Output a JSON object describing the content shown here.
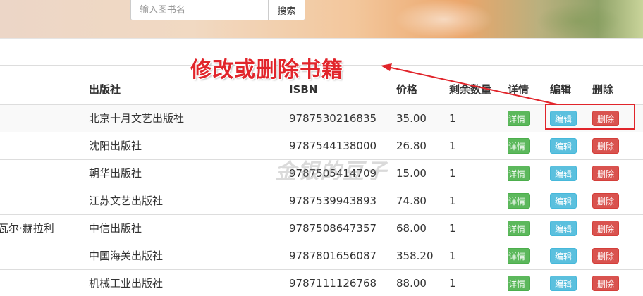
{
  "search": {
    "placeholder": "输入图书名",
    "button_label": "搜索"
  },
  "table": {
    "headers": {
      "publisher": "出版社",
      "isbn": "ISBN",
      "price": "价格",
      "remaining": "剩余数量",
      "detail": "详情",
      "edit": "编辑",
      "delete": "删除"
    },
    "rows": [
      {
        "author": "",
        "publisher": "北京十月文艺出版社",
        "isbn": "9787530216835",
        "price": "35.00",
        "remaining": "1"
      },
      {
        "author": "",
        "publisher": "沈阳出版社",
        "isbn": "9787544138000",
        "price": "26.80",
        "remaining": "1"
      },
      {
        "author": "",
        "publisher": "朝华出版社",
        "isbn": "9787505414709",
        "price": "15.00",
        "remaining": "1"
      },
      {
        "author": "",
        "publisher": "江苏文艺出版社",
        "isbn": "9787539943893",
        "price": "74.80",
        "remaining": "1"
      },
      {
        "author": "瓦尔·赫拉利",
        "publisher": "中信出版社",
        "isbn": "9787508647357",
        "price": "68.00",
        "remaining": "1"
      },
      {
        "author": "",
        "publisher": "中国海关出版社",
        "isbn": "9787801656087",
        "price": "358.20",
        "remaining": "1"
      },
      {
        "author": "",
        "publisher": "机械工业出版社",
        "isbn": "9787111126768",
        "price": "88.00",
        "remaining": "1"
      }
    ],
    "button_labels": {
      "detail": "详情",
      "edit": "编辑",
      "delete": "删除"
    }
  },
  "annotation": {
    "text": "修改或删除书籍",
    "color": "#e1252b"
  },
  "watermark": "金银的豆子",
  "colors": {
    "detail_btn": "#5cb85c",
    "edit_btn": "#5bc0de",
    "delete_btn": "#d9534f"
  }
}
